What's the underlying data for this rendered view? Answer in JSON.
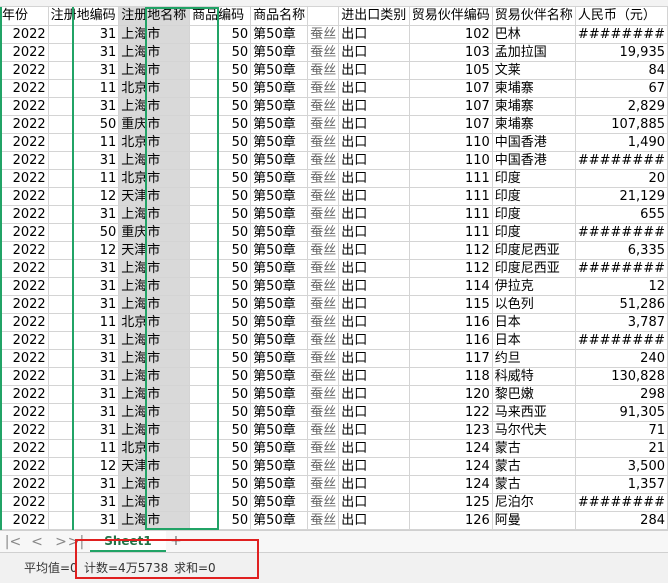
{
  "columns": [
    "年份",
    "注册地编码",
    "注册地名称",
    "商品编码",
    "商品名称",
    "进出口类别",
    "贸易伙伴编码",
    "贸易伙伴名称",
    "人民币（元）"
  ],
  "rows": [
    [
      "2022",
      "31",
      "上海市",
      "50",
      "第50章",
      "蚕丝",
      "出口",
      "102",
      "巴林",
      "########"
    ],
    [
      "2022",
      "31",
      "上海市",
      "50",
      "第50章",
      "蚕丝",
      "出口",
      "103",
      "孟加拉国",
      "19,935"
    ],
    [
      "2022",
      "31",
      "上海市",
      "50",
      "第50章",
      "蚕丝",
      "出口",
      "105",
      "文莱",
      "84"
    ],
    [
      "2022",
      "11",
      "北京市",
      "50",
      "第50章",
      "蚕丝",
      "出口",
      "107",
      "柬埔寨",
      "67"
    ],
    [
      "2022",
      "31",
      "上海市",
      "50",
      "第50章",
      "蚕丝",
      "出口",
      "107",
      "柬埔寨",
      "2,829"
    ],
    [
      "2022",
      "50",
      "重庆市",
      "50",
      "第50章",
      "蚕丝",
      "出口",
      "107",
      "柬埔寨",
      "107,885"
    ],
    [
      "2022",
      "11",
      "北京市",
      "50",
      "第50章",
      "蚕丝",
      "出口",
      "110",
      "中国香港",
      "1,490"
    ],
    [
      "2022",
      "31",
      "上海市",
      "50",
      "第50章",
      "蚕丝",
      "出口",
      "110",
      "中国香港",
      "########"
    ],
    [
      "2022",
      "11",
      "北京市",
      "50",
      "第50章",
      "蚕丝",
      "出口",
      "111",
      "印度",
      "20"
    ],
    [
      "2022",
      "12",
      "天津市",
      "50",
      "第50章",
      "蚕丝",
      "出口",
      "111",
      "印度",
      "21,129"
    ],
    [
      "2022",
      "31",
      "上海市",
      "50",
      "第50章",
      "蚕丝",
      "出口",
      "111",
      "印度",
      "655"
    ],
    [
      "2022",
      "50",
      "重庆市",
      "50",
      "第50章",
      "蚕丝",
      "出口",
      "111",
      "印度",
      "########"
    ],
    [
      "2022",
      "12",
      "天津市",
      "50",
      "第50章",
      "蚕丝",
      "出口",
      "112",
      "印度尼西亚",
      "6,335"
    ],
    [
      "2022",
      "31",
      "上海市",
      "50",
      "第50章",
      "蚕丝",
      "出口",
      "112",
      "印度尼西亚",
      "########"
    ],
    [
      "2022",
      "31",
      "上海市",
      "50",
      "第50章",
      "蚕丝",
      "出口",
      "114",
      "伊拉克",
      "12"
    ],
    [
      "2022",
      "31",
      "上海市",
      "50",
      "第50章",
      "蚕丝",
      "出口",
      "115",
      "以色列",
      "51,286"
    ],
    [
      "2022",
      "11",
      "北京市",
      "50",
      "第50章",
      "蚕丝",
      "出口",
      "116",
      "日本",
      "3,787"
    ],
    [
      "2022",
      "31",
      "上海市",
      "50",
      "第50章",
      "蚕丝",
      "出口",
      "116",
      "日本",
      "########"
    ],
    [
      "2022",
      "31",
      "上海市",
      "50",
      "第50章",
      "蚕丝",
      "出口",
      "117",
      "约旦",
      "240"
    ],
    [
      "2022",
      "31",
      "上海市",
      "50",
      "第50章",
      "蚕丝",
      "出口",
      "118",
      "科威特",
      "130,828"
    ],
    [
      "2022",
      "31",
      "上海市",
      "50",
      "第50章",
      "蚕丝",
      "出口",
      "120",
      "黎巴嫩",
      "298"
    ],
    [
      "2022",
      "31",
      "上海市",
      "50",
      "第50章",
      "蚕丝",
      "出口",
      "122",
      "马来西亚",
      "91,305"
    ],
    [
      "2022",
      "31",
      "上海市",
      "50",
      "第50章",
      "蚕丝",
      "出口",
      "123",
      "马尔代夫",
      "71"
    ],
    [
      "2022",
      "11",
      "北京市",
      "50",
      "第50章",
      "蚕丝",
      "出口",
      "124",
      "蒙古",
      "21"
    ],
    [
      "2022",
      "12",
      "天津市",
      "50",
      "第50章",
      "蚕丝",
      "出口",
      "124",
      "蒙古",
      "3,500"
    ],
    [
      "2022",
      "31",
      "上海市",
      "50",
      "第50章",
      "蚕丝",
      "出口",
      "124",
      "蒙古",
      "1,357"
    ],
    [
      "2022",
      "31",
      "上海市",
      "50",
      "第50章",
      "蚕丝",
      "出口",
      "125",
      "尼泊尔",
      "########"
    ],
    [
      "2022",
      "31",
      "上海市",
      "50",
      "第50章",
      "蚕丝",
      "出口",
      "126",
      "阿曼",
      "284"
    ]
  ],
  "tabs": {
    "sheet": "Sheet1",
    "add": "+"
  },
  "nav": {
    "first": "|<",
    "prev": "<",
    "next": ">",
    "last": ">|"
  },
  "status": {
    "average": "平均值=0",
    "count": "计数=4万5738",
    "sum": "求和=0"
  },
  "colors": {
    "selection_border": "#21a366",
    "selection_fill": "#d9d9d9",
    "highlight_box": "#e02020"
  }
}
